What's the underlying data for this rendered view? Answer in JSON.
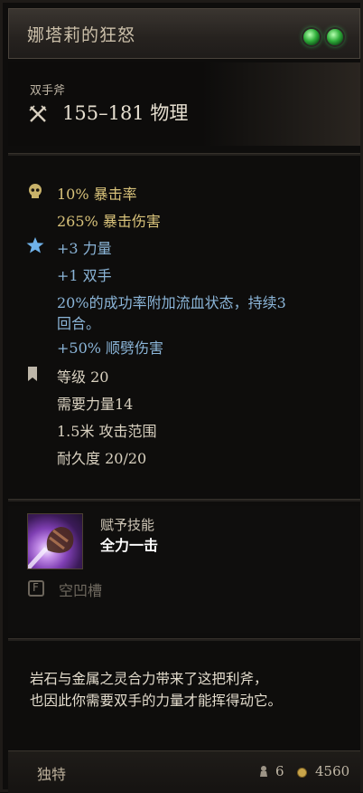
{
  "item": {
    "title": "娜塔莉的狂怒",
    "type": "双手斧",
    "damage": "155–181 物理"
  },
  "stats": {
    "crit_chance": "10% 暴击率",
    "crit_damage": "265% 暴击伤害",
    "bonus_strength": "+3 力量",
    "bonus_twohanded": "+1 双手",
    "bleed_line1": "20%的成功率附加流血状态，持续3",
    "bleed_line2": "回合。",
    "cleave": "+50% 顺劈伤害",
    "level": "等级 20",
    "requirement": "需要力量14",
    "range": "1.5米 攻击范围",
    "durability": "耐久度 20/20"
  },
  "skill": {
    "granted_label": "赋予技能",
    "name": "全力一击",
    "empty_slot": "空凹槽",
    "slot_letter": "F"
  },
  "description": {
    "line1": "岩石与金属之灵合力带来了这把利斧，",
    "line2": "也因此你需要双手的力量才能挥得动它。"
  },
  "footer": {
    "rarity": "独特",
    "weight": "6",
    "value": "4560"
  },
  "colors": {
    "gold_text": "#d8c27a",
    "blue_text": "#8bb5d8",
    "gem_green": "#2fae3a"
  }
}
